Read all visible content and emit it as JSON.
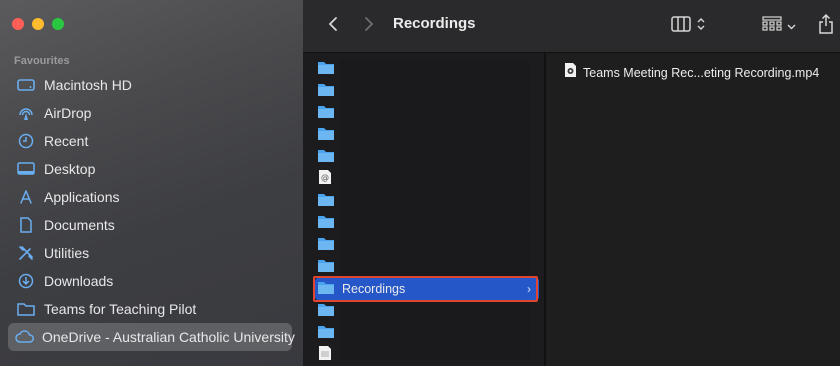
{
  "window": {
    "title": "Recordings"
  },
  "sidebar": {
    "section_title": "Favourites",
    "items": [
      {
        "label": "Macintosh HD",
        "icon": "harddisk-icon"
      },
      {
        "label": "AirDrop",
        "icon": "airdrop-icon"
      },
      {
        "label": "Recent",
        "icon": "clock-icon"
      },
      {
        "label": "Desktop",
        "icon": "desktop-icon"
      },
      {
        "label": "Applications",
        "icon": "applications-icon"
      },
      {
        "label": "Documents",
        "icon": "document-icon"
      },
      {
        "label": "Utilities",
        "icon": "utilities-icon"
      },
      {
        "label": "Downloads",
        "icon": "download-icon"
      },
      {
        "label": "Teams for Teaching Pilot",
        "icon": "folder-icon"
      },
      {
        "label": "OneDrive - Australian Catholic University",
        "icon": "cloud-icon",
        "selected": true
      }
    ]
  },
  "toolbar": {
    "back_icon": "chevron-left-icon",
    "forward_icon": "chevron-right-icon",
    "view_icon": "column-view-icon",
    "group_icon": "grid-view-icon",
    "share_icon": "share-icon"
  },
  "column1": {
    "items": [
      {
        "type": "folder",
        "label": ""
      },
      {
        "type": "folder",
        "label": ""
      },
      {
        "type": "folder",
        "label": ""
      },
      {
        "type": "folder",
        "label": ""
      },
      {
        "type": "folder",
        "label": ""
      },
      {
        "type": "email",
        "label": ""
      },
      {
        "type": "folder",
        "label": ""
      },
      {
        "type": "folder",
        "label": ""
      },
      {
        "type": "folder",
        "label": ""
      },
      {
        "type": "folder",
        "label": ""
      },
      {
        "type": "folder",
        "label": "Recordings",
        "selected": true
      },
      {
        "type": "folder",
        "label": ""
      },
      {
        "type": "folder",
        "label": ""
      },
      {
        "type": "document",
        "label": ""
      }
    ]
  },
  "column2": {
    "file": {
      "label": "Teams Meeting Rec...eting Recording.mp4",
      "icon": "video-file-icon"
    }
  },
  "colors": {
    "accent": "#2557c8",
    "highlight_border": "#e0452f",
    "folder": "#4aa3ee"
  }
}
